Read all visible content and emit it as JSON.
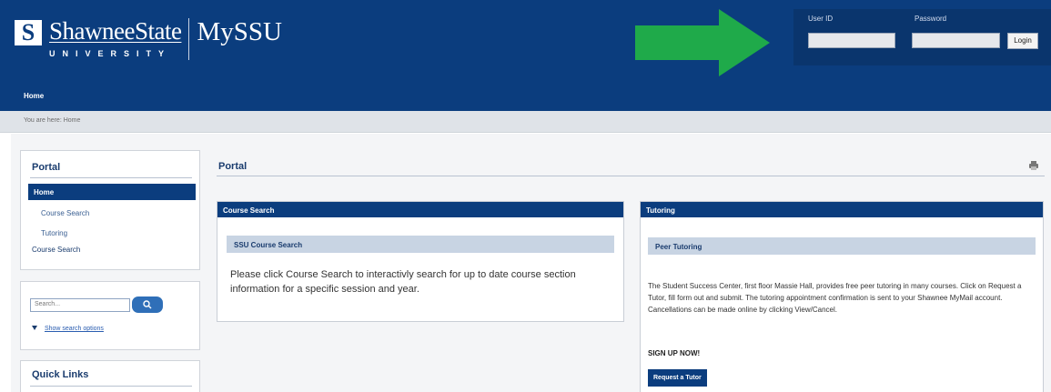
{
  "header": {
    "logo_mark": "S",
    "logo_name": "ShawneeState",
    "logo_sub": "UNIVERSITY",
    "product": "MySSU",
    "nav_home": "Home"
  },
  "login": {
    "user_label": "User ID",
    "password_label": "Password",
    "button_label": "Login",
    "user_value": "",
    "password_value": ""
  },
  "breadcrumb": "You are here: Home",
  "sidebar": {
    "portal_title": "Portal",
    "items": [
      {
        "label": "Home",
        "active": true
      },
      {
        "label": "Course Search"
      },
      {
        "label": "Tutoring"
      },
      {
        "label": "Course Search"
      }
    ],
    "search_placeholder": "Search...",
    "search_options": "Show search options",
    "quick_links_title": "Quick Links"
  },
  "main": {
    "title": "Portal",
    "course_search": {
      "header": "Course Search",
      "sub_title": "SSU Course Search",
      "body": "Please click Course Search to interactivly search for up to date course section information for a specific session and year."
    },
    "tutoring": {
      "header": "Tutoring",
      "sub_title": "Peer Tutoring",
      "body": "The Student Success Center, first floor Massie Hall, provides free peer tutoring in many courses. Click on Request a Tutor, fill form out and submit. The tutoring appointment confirmation is sent to your Shawnee MyMail account. Cancellations can be made online by clicking View/Cancel.",
      "signup": "SIGN UP NOW!",
      "button": "Request a Tutor"
    }
  },
  "colors": {
    "header_blue": "#0b3d7e",
    "arrow_green": "#1faa4a",
    "sub_header": "#c8d4e3"
  },
  "icons": {
    "search": "search-icon",
    "print": "print-icon",
    "arrow": "arrow-right-icon",
    "triangle": "triangle-down-icon"
  }
}
